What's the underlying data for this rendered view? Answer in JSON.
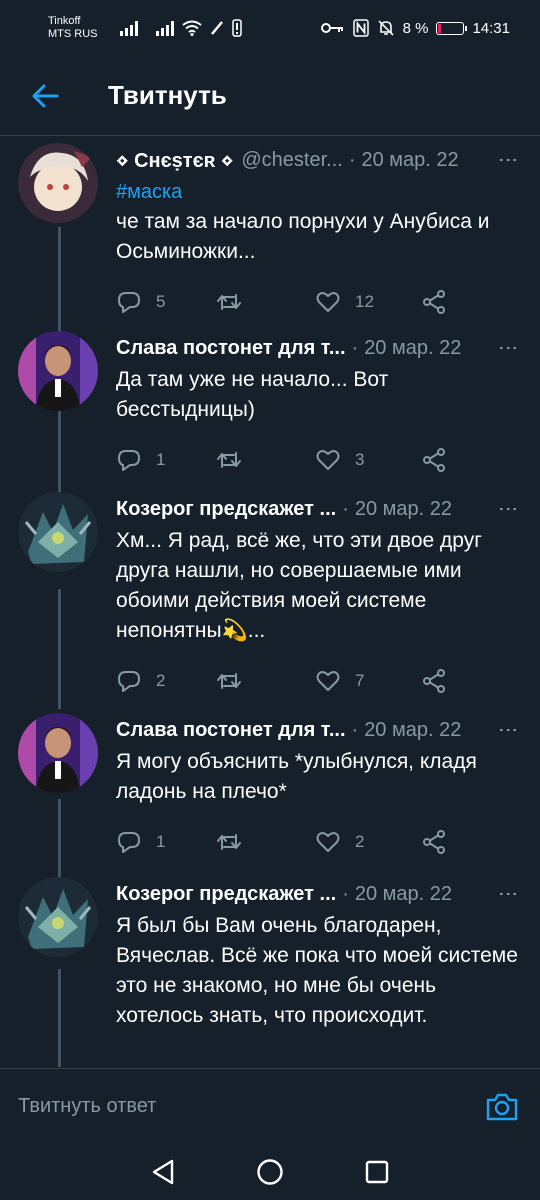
{
  "status": {
    "carrier1": "Tinkoff",
    "carrier2": "MTS RUS",
    "battery": "8 %",
    "time": "14:31"
  },
  "header": {
    "title": "Твитнуть"
  },
  "tweets": [
    {
      "name": "⋄ Cнєṣтєʀ ⋄",
      "handle": "@chester...",
      "date": "20 мар. 22",
      "tag": "#маска",
      "text": "че там за начало порнухи у Анубиса и Осьминожки...",
      "replies": "5",
      "retweets": "",
      "likes": "12"
    },
    {
      "name": "Слава постонет для т...",
      "handle": "",
      "date": "20 мар. 22",
      "tag": "",
      "text": "Да там уже не начало... Вот бесстыдницы)",
      "replies": "1",
      "retweets": "",
      "likes": "3"
    },
    {
      "name": "Козерог предскажет ...",
      "handle": "",
      "date": "20 мар. 22",
      "tag": "",
      "text": "Хм... Я рад, всё же, что эти двое друг друга нашли, но совершаемые ими обоими действия моей системе непонятны💫...",
      "replies": "2",
      "retweets": "",
      "likes": "7"
    },
    {
      "name": "Слава постонет для т...",
      "handle": "",
      "date": "20 мар. 22",
      "tag": "",
      "text": "Я могу объяснить *улыбнулся, кладя ладонь на плечо*",
      "replies": "1",
      "retweets": "",
      "likes": "2"
    },
    {
      "name": "Козерог предскажет ...",
      "handle": "",
      "date": "20 мар. 22",
      "tag": "",
      "text": "Я был бы Вам очень благодарен, Вячеслав. Всё же пока что моей системе это не знакомо, но мне бы очень хотелось знать, что происходит.",
      "replies": "",
      "retweets": "",
      "likes": ""
    }
  ],
  "reply": {
    "placeholder": "Твитнуть ответ"
  },
  "colors": {
    "bg": "#15202b",
    "accent": "#1da1f2",
    "muted": "#8899a6"
  }
}
